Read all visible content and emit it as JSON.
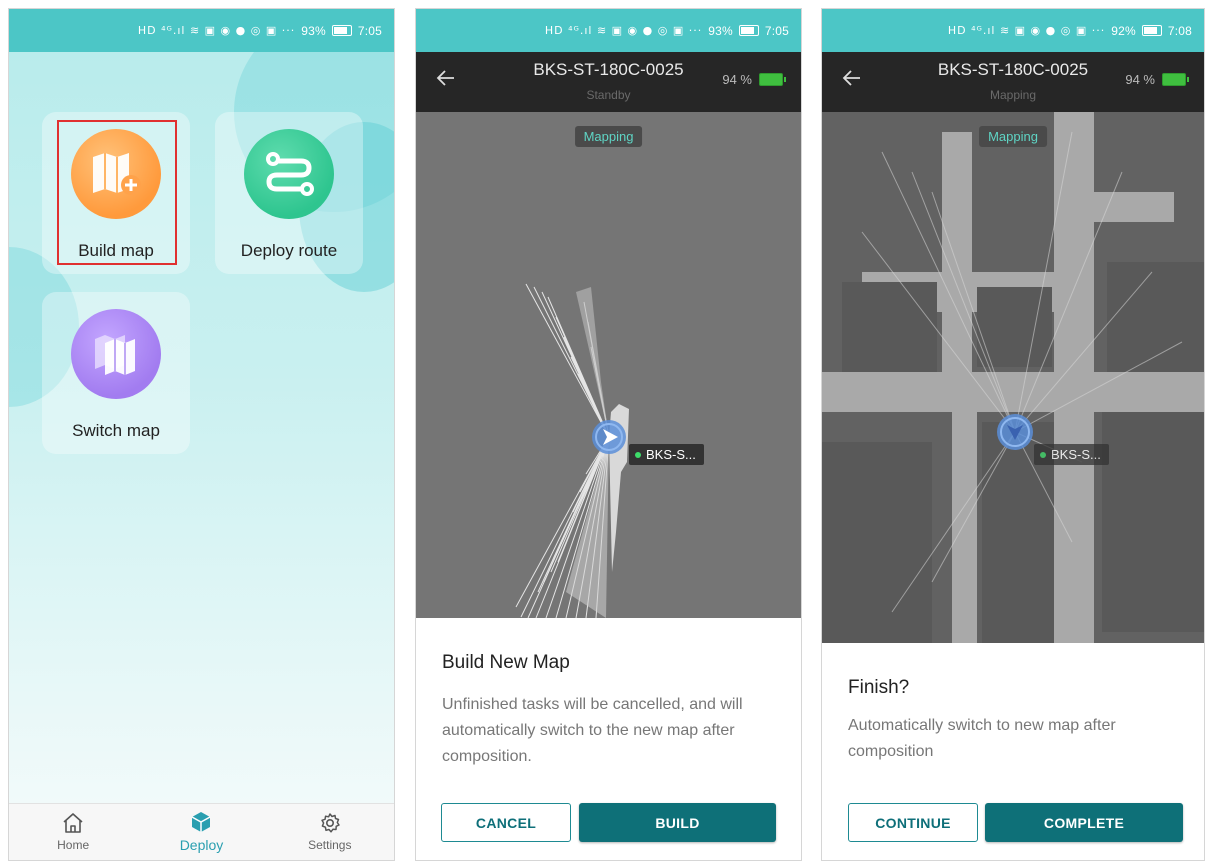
{
  "status_bar": {
    "left": {
      "glyphs": "HD ⁴ᴳ.ıl ≋ ▣ ◉ ● ◎ ▣ ···",
      "battery": "93%",
      "time": "7:05"
    },
    "middle": {
      "glyphs": "HD ⁴ᴳ.ıl ≋ ▣ ◉ ● ◎ ▣ ···",
      "battery": "93%",
      "time": "7:05"
    },
    "right": {
      "glyphs": "HD ⁴ᴳ.ıl ≋ ▣ ◉ ● ◎ ▣ ···",
      "battery": "92%",
      "time": "7:08"
    }
  },
  "deploy_screen": {
    "tiles": [
      {
        "label": "Build map",
        "icon": "map-plus-icon",
        "color": "#ff9a3c",
        "highlighted": true
      },
      {
        "label": "Deploy route",
        "icon": "route-icon",
        "color": "#2ec58f"
      },
      {
        "label": "Switch map",
        "icon": "map-switch-icon",
        "color": "#a27cf0"
      }
    ],
    "tabs": [
      {
        "label": "Home",
        "icon": "home-icon"
      },
      {
        "label": "Deploy",
        "icon": "deploy-cube-icon",
        "active": true
      },
      {
        "label": "Settings",
        "icon": "gear-icon"
      }
    ]
  },
  "build_screen": {
    "robot_name": "BKS-ST-180C-0025",
    "robot_status": "Standby",
    "battery": "94 %",
    "mode_chip": "Mapping",
    "robot_label": "BKS-S...",
    "dialog": {
      "title": "Build New Map",
      "text": "Unfinished tasks will be cancelled, and will automatically switch to the new map after composition.",
      "cancel": "CANCEL",
      "confirm": "BUILD"
    }
  },
  "finish_screen": {
    "robot_name": "BKS-ST-180C-0025",
    "robot_status": "Mapping",
    "battery": "94 %",
    "mode_chip": "Mapping",
    "robot_label": "BKS-S...",
    "dialog": {
      "title": "Finish?",
      "text": "Automatically switch to new map after composition",
      "cancel": "CONTINUE",
      "confirm": "COMPLETE"
    }
  },
  "colors": {
    "status_bar": "#4cc6c6",
    "accent": "#0e7078",
    "active_tab": "#2a9fb0",
    "highlight": "#e03030"
  }
}
